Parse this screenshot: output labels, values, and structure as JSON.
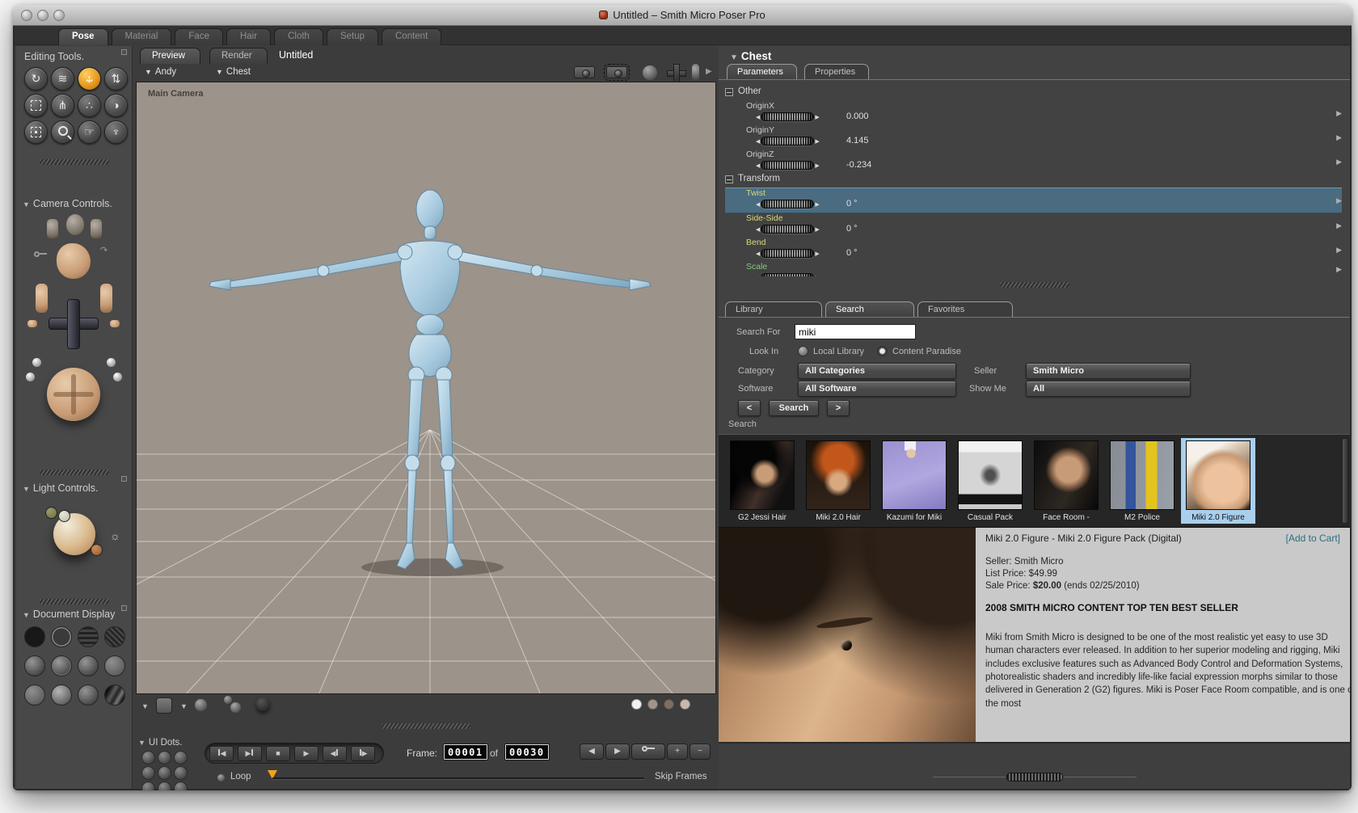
{
  "window": {
    "title": "Untitled – Smith Micro Poser Pro"
  },
  "room_tabs": {
    "active": "Pose",
    "items": [
      {
        "label": "Pose"
      },
      {
        "label": "Material"
      },
      {
        "label": "Face"
      },
      {
        "label": "Hair"
      },
      {
        "label": "Cloth"
      },
      {
        "label": "Setup"
      },
      {
        "label": "Content"
      }
    ]
  },
  "sidebar": {
    "editing_tools": {
      "title": "Editing Tools.",
      "tools": [
        {
          "name": "rotate"
        },
        {
          "name": "twist"
        },
        {
          "name": "translate-pan",
          "selected": true
        },
        {
          "name": "translate-in-out"
        },
        {
          "name": "scale"
        },
        {
          "name": "taper"
        },
        {
          "name": "morphing-tool"
        },
        {
          "name": "color"
        },
        {
          "name": "grouping"
        },
        {
          "name": "view-magnifier"
        },
        {
          "name": "direct-manipulation"
        },
        {
          "name": "light"
        }
      ]
    },
    "camera_controls": {
      "title": "Camera Controls."
    },
    "light_controls": {
      "title": "Light Controls."
    },
    "document_display": {
      "title": "Document Display"
    }
  },
  "document": {
    "tabs": [
      {
        "label": "Preview"
      },
      {
        "label": "Render"
      }
    ],
    "active_tab": "Preview",
    "doc_title": "Untitled",
    "actor_selector": "Andy",
    "element_selector": "Chest",
    "camera_name": "Main Camera"
  },
  "animation": {
    "ui_dots_title": "UI Dots.",
    "frame_label": "Frame:",
    "current_frame": "00001",
    "of_label": "of",
    "total_frames": "00030",
    "loop_label": "Loop",
    "skip_frames_label": "Skip Frames"
  },
  "parameters": {
    "header": "Chest",
    "active_tab": "Parameters",
    "tabs": [
      {
        "label": "Parameters"
      },
      {
        "label": "Properties"
      }
    ],
    "groups": [
      {
        "name": "Other",
        "params": [
          {
            "label": "OriginX",
            "value": "0.000"
          },
          {
            "label": "OriginY",
            "value": "4.145"
          },
          {
            "label": "OriginZ",
            "value": "-0.234"
          }
        ]
      },
      {
        "name": "Transform",
        "params": [
          {
            "label": "Twist",
            "value": "0 °",
            "selected": true
          },
          {
            "label": "Side-Side",
            "value": "0 °"
          },
          {
            "label": "Bend",
            "value": "0 °"
          },
          {
            "label": "Scale",
            "value": ""
          }
        ]
      }
    ]
  },
  "library": {
    "active_tab": "Search",
    "tabs": [
      {
        "label": "Library"
      },
      {
        "label": "Search"
      },
      {
        "label": "Favorites"
      }
    ],
    "form": {
      "search_for_label": "Search For",
      "search_value": "miki",
      "look_in_label": "Look In",
      "options": [
        {
          "label": "Local Library",
          "selected": false
        },
        {
          "label": "Content Paradise",
          "selected": true
        }
      ],
      "category_label": "Category",
      "category_value": "All Categories",
      "seller_label": "Seller",
      "seller_value": "Smith Micro",
      "software_label": "Software",
      "software_value": "All Software",
      "show_me_label": "Show Me",
      "show_me_value": "All",
      "prev_label": "<",
      "search_label": "Search",
      "next_label": ">"
    },
    "results_title": "Search",
    "results": [
      {
        "label": "G2 Jessi Hair"
      },
      {
        "label": "Miki 2.0 Hair"
      },
      {
        "label": "Kazumi for Miki"
      },
      {
        "label": "Casual Pack"
      },
      {
        "label": "Face Room -"
      },
      {
        "label": "M2 Police"
      },
      {
        "label": "Miki 2.0 Figure",
        "selected": true
      }
    ],
    "product": {
      "title": "Miki 2.0 Figure - Miki 2.0 Figure Pack (Digital)",
      "add_to_cart_label": "[Add to Cart]",
      "seller_line": "Seller: Smith Micro",
      "list_price_line": "List Price: $49.99",
      "sale_price_prefix": "Sale Price: ",
      "sale_price_value": "$20.00",
      "sale_price_suffix": " (ends 02/25/2010)",
      "banner": "2008 SMITH MICRO CONTENT TOP TEN BEST SELLER",
      "description": "Miki from Smith Micro is designed to be one of the most realistic yet easy to use 3D human characters ever released. In addition to her superior modeling and rigging, Miki includes exclusive features such as Advanced Body Control and Deformation Systems, photorealistic shaders and incredibly life-like facial expression morphs similar to those delivered in Generation 2 (G2) figures. Miki is Poser Face Room compatible, and is one of the most"
    }
  },
  "colors": {
    "selection_row": "#4a6b80",
    "thumb_selection": "#a9cfec",
    "accent_orange": "#f0a21e",
    "link_teal": "#2e6e7e"
  }
}
